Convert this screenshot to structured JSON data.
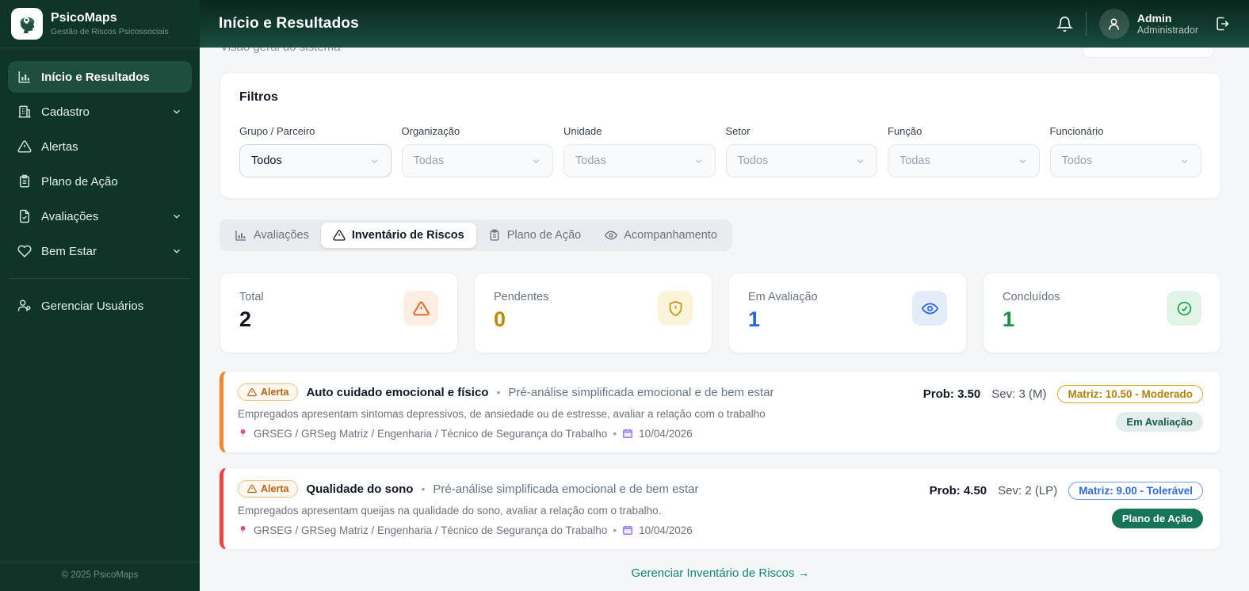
{
  "brand": {
    "name": "PsicoMaps",
    "tagline": "Gestão de Riscos Psicossociais"
  },
  "sidebar": {
    "items": [
      {
        "label": "Início e Resultados"
      },
      {
        "label": "Cadastro"
      },
      {
        "label": "Alertas"
      },
      {
        "label": "Plano de Ação"
      },
      {
        "label": "Avaliações"
      },
      {
        "label": "Bem Estar"
      },
      {
        "label": "Gerenciar Usuários"
      }
    ],
    "footer": "© 2025 PsicoMaps"
  },
  "header": {
    "title": "Início e Resultados",
    "user": {
      "name": "Admin",
      "role": "Administrador"
    }
  },
  "page": {
    "subtitle": "Visão geral do sistema"
  },
  "filters": {
    "title": "Filtros",
    "fields": [
      {
        "label": "Grupo / Parceiro",
        "value": "Todos"
      },
      {
        "label": "Organização",
        "value": "Todas"
      },
      {
        "label": "Unidade",
        "value": "Todas"
      },
      {
        "label": "Setor",
        "value": "Todos"
      },
      {
        "label": "Função",
        "value": "Todas"
      },
      {
        "label": "Funcionário",
        "value": "Todos"
      }
    ]
  },
  "tabs": [
    {
      "label": "Avaliações"
    },
    {
      "label": "Inventário de Riscos"
    },
    {
      "label": "Plano de Ação"
    },
    {
      "label": "Acompanhamento"
    }
  ],
  "stats": [
    {
      "label": "Total",
      "value": "2",
      "value_color": "#111827",
      "icon": "warning-triangle",
      "icon_color": "#ea580c",
      "icon_bg": "#fdeee3"
    },
    {
      "label": "Pendentes",
      "value": "0",
      "value_color": "#c08a06",
      "icon": "shield-alert",
      "icon_color": "#c99708",
      "icon_bg": "#fcf4da"
    },
    {
      "label": "Em Avaliação",
      "value": "1",
      "value_color": "#2563eb",
      "icon": "eye",
      "icon_color": "#2563eb",
      "icon_bg": "#e4ecfa"
    },
    {
      "label": "Concluídos",
      "value": "1",
      "value_color": "#15943d",
      "icon": "check-circle",
      "icon_color": "#16a34a",
      "icon_bg": "#e1f4e7"
    }
  ],
  "risks": [
    {
      "badge": "Alerta",
      "title": "Auto cuidado emocional e físico",
      "dot": "•",
      "subtitle": "Pré-análise simplificada emocional e de bem estar",
      "description": "Empregados apresentam sintomas depressivos, de ansiedade ou de estresse, avaliar a relação com o trabalho",
      "location": "GRSEG / GRSeg Matriz / Engenharia / Técnico de Segurança do Trabalho",
      "date": "10/04/2026",
      "prob": "Prob: 3.50",
      "sev": "Sev: 3 (M)",
      "matrix": "Matriz: 10.50 - Moderado",
      "status": "Em Avaliação",
      "accent_color": "#f5862b"
    },
    {
      "badge": "Alerta",
      "title": "Qualidade do sono",
      "dot": "•",
      "subtitle": "Pré-análise simplificada emocional e de bem estar",
      "description": "Empregados apresentam queijas na qualidade do sono, avaliar a relação com o trabalho.",
      "location": "GRSEG / GRSeg Matriz / Engenharia / Técnico de Segurança do Trabalho",
      "date": "10/04/2026",
      "prob": "Prob: 4.50",
      "sev": "Sev: 2 (LP)",
      "matrix": "Matriz: 9.00 - Tolerável",
      "status": "Plano de Ação",
      "accent_color": "#ef4444"
    }
  ],
  "footer_link": "Gerenciar Inventário de Riscos →",
  "colors": {
    "sidebar_bg": "#0e3528",
    "header_gradient_end": "#1a5041",
    "active_item_bg": "#1e4e3e",
    "link_teal": "#0f8b72"
  }
}
